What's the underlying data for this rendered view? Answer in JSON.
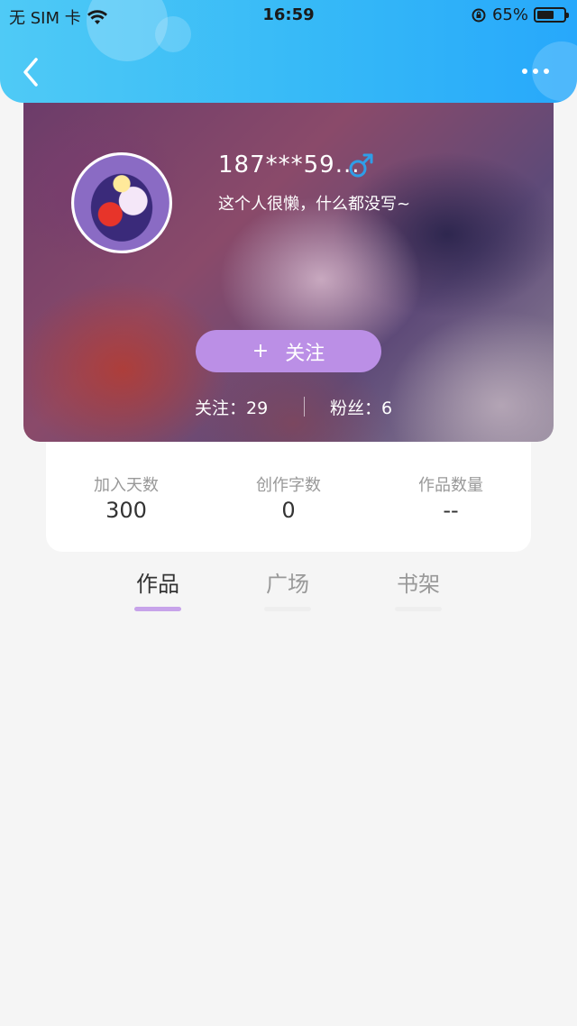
{
  "status_bar": {
    "carrier": "无 SIM 卡",
    "time": "16:59",
    "battery_percent": "65%",
    "battery_level": 0.65
  },
  "header": {
    "back_icon": "chevron-left-icon",
    "more_icon": "more-dots-icon"
  },
  "profile": {
    "username": "187***59...",
    "gender_icon": "male-icon",
    "bio": "这个人很懒，什么都没写~",
    "follow_button": {
      "icon": "+",
      "label": "关注"
    },
    "following": "关注：29",
    "fans": "粉丝：6"
  },
  "stats": [
    {
      "label": "加入天数",
      "value": "300"
    },
    {
      "label": "创作字数",
      "value": "0"
    },
    {
      "label": "作品数量",
      "value": "--"
    }
  ],
  "tabs": [
    {
      "label": "作品",
      "active": true
    },
    {
      "label": "广场",
      "active": false
    },
    {
      "label": "书架",
      "active": false
    }
  ],
  "colors": {
    "header_start": "#4fcaf6",
    "header_end": "#27a8fb",
    "accent_purple": "#bb8fe6",
    "gender_blue": "#2f9ee8",
    "page_bg": "#f5f5f5"
  }
}
